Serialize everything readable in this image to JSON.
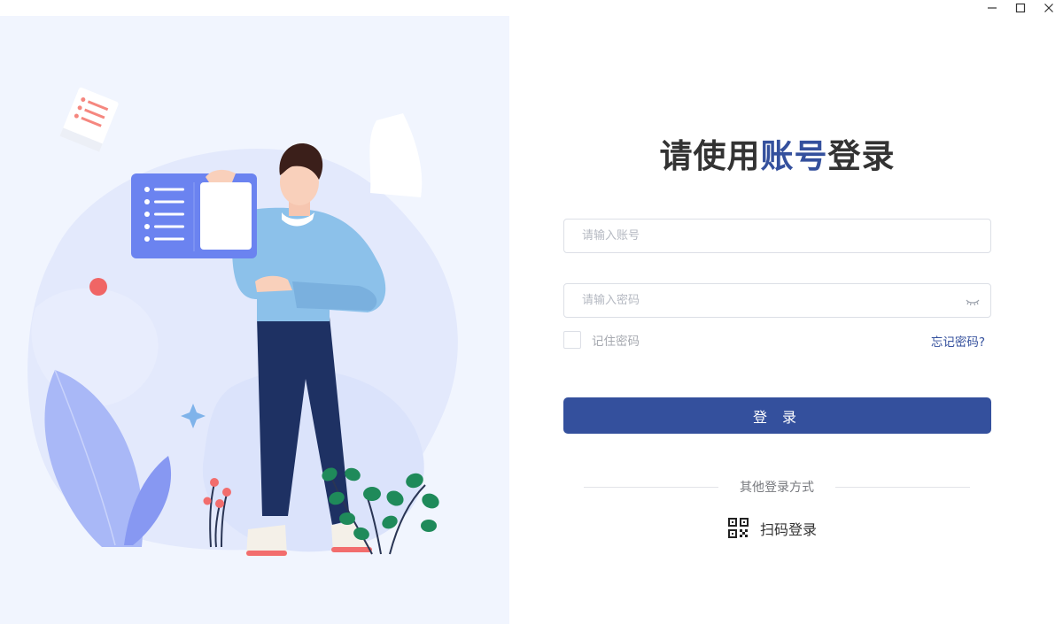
{
  "window": {
    "controls": [
      "minimize-icon",
      "maximize-icon",
      "close-icon"
    ]
  },
  "login": {
    "title_prefix": "请使用",
    "title_accent": "账号",
    "title_suffix": "登录",
    "account_placeholder": "请输入账号",
    "account_value": "",
    "password_placeholder": "请输入密码",
    "password_value": "",
    "password_toggle_icon": "eye-closed-icon",
    "remember_label": "记住密码",
    "remember_checked": false,
    "forgot_label": "忘记密码?",
    "submit_label": "登 录",
    "other_methods_label": "其他登录方式",
    "qr_login_label": "扫码登录",
    "qr_icon": "qr-code-icon"
  },
  "colors": {
    "accent": "#34509d",
    "illustration_bg": "#f1f5fe",
    "border": "#dcdfe6"
  }
}
